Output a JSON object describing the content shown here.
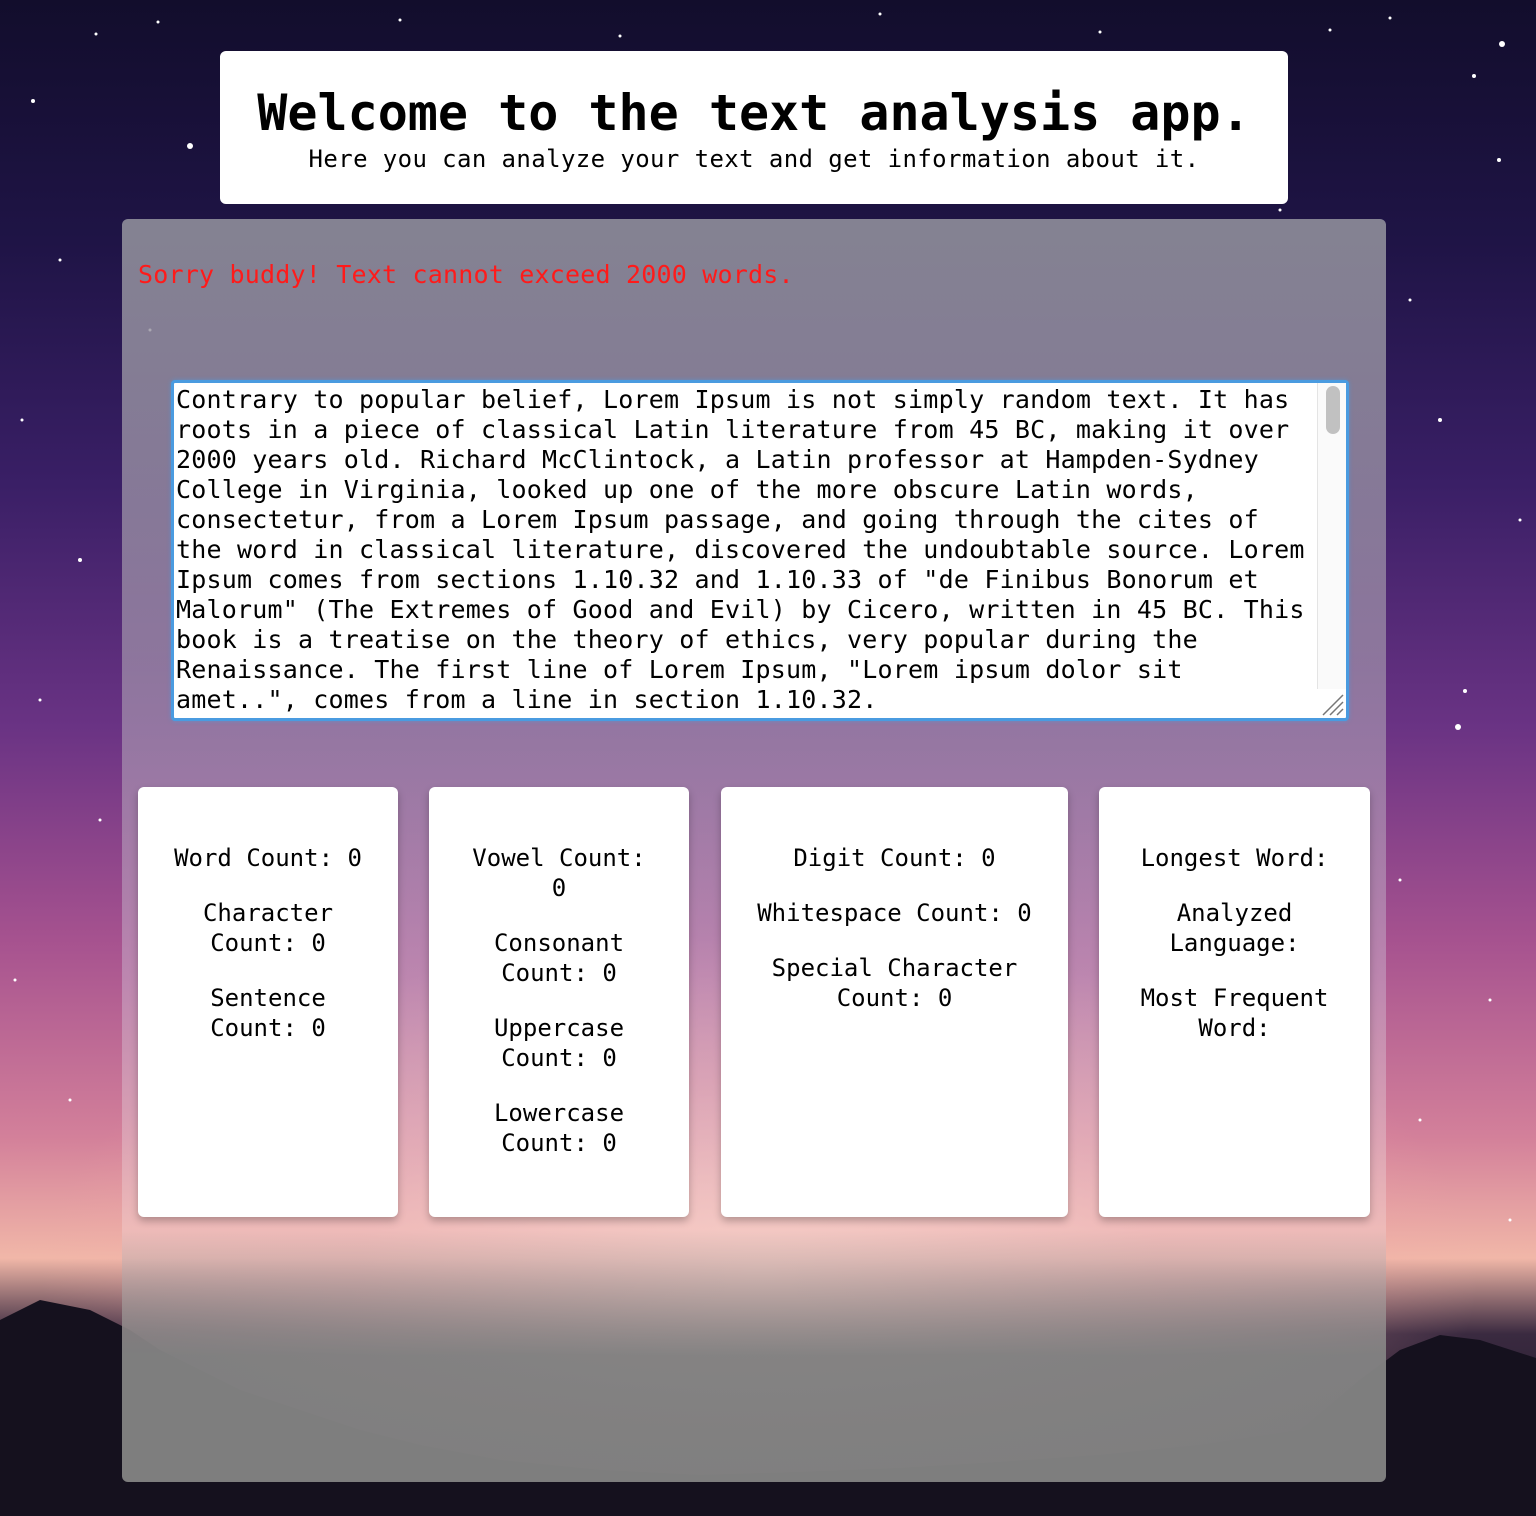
{
  "header": {
    "title": "Welcome to the text analysis app.",
    "subtitle": "Here you can analyze your text and get information about it."
  },
  "error": {
    "message": "Sorry buddy! Text cannot exceed 2000 words.",
    "color": "#ff1a1a"
  },
  "editor": {
    "text": "Contrary to popular belief, Lorem Ipsum is not simply random text. It has roots in a piece of classical Latin literature from 45 BC, making it over 2000 years old. Richard McClintock, a Latin professor at Hampden-Sydney College in Virginia, looked up one of the more obscure Latin words, consectetur, from a Lorem Ipsum passage, and going through the cites of the word in classical literature, discovered the undoubtable source. Lorem Ipsum comes from sections 1.10.32 and 1.10.33 of \"de Finibus Bonorum et Malorum\" (The Extremes of Good and Evil) by Cicero, written in 45 BC. This book is a treatise on the theory of ethics, very popular during the Renaissance. The first line of Lorem Ipsum, \"Lorem ipsum dolor sit amet..\", comes from a line in section 1.10.32.",
    "focus_color": "#4a9be0"
  },
  "stats": {
    "word_count": "Word Count: 0",
    "character_count": "Character Count: 0",
    "sentence_count": "Sentence Count: 0",
    "vowel_count": "Vowel Count: 0",
    "consonant_count": "Consonant Count: 0",
    "uppercase_count": "Uppercase Count: 0",
    "lowercase_count": "Lowercase Count: 0",
    "digit_count": "Digit Count: 0",
    "whitespace_count": "Whitespace Count: 0",
    "special_character_count": "Special Character Count: 0",
    "longest_word": "Longest Word:",
    "analyzed_language": "Analyzed Language:",
    "most_frequent_word": "Most Frequent Word:"
  }
}
